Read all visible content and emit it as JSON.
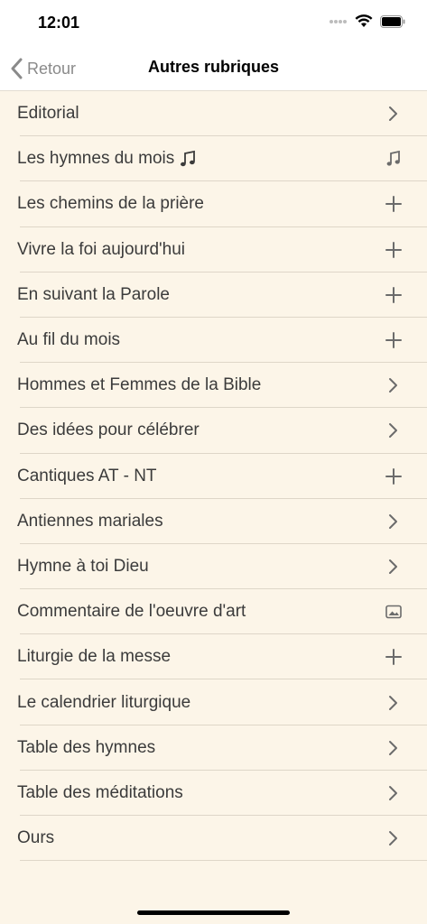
{
  "status": {
    "time": "12:01"
  },
  "nav": {
    "back_label": "Retour",
    "title": "Autres rubriques"
  },
  "items": [
    {
      "label": "Editorial",
      "icon": "chevron-right"
    },
    {
      "label": "Les hymnes du mois",
      "label_icon": "music-note",
      "icon": "music-note"
    },
    {
      "label": "Les chemins de la prière",
      "icon": "plus"
    },
    {
      "label": "Vivre la foi aujourd'hui",
      "icon": "plus"
    },
    {
      "label": "En suivant la Parole",
      "icon": "plus"
    },
    {
      "label": "Au fil du mois",
      "icon": "plus"
    },
    {
      "label": "Hommes et Femmes de la Bible",
      "icon": "chevron-right"
    },
    {
      "label": "Des idées pour célébrer",
      "icon": "chevron-right"
    },
    {
      "label": "Cantiques AT - NT",
      "icon": "plus"
    },
    {
      "label": "Antiennes mariales",
      "icon": "chevron-right"
    },
    {
      "label": "Hymne à toi Dieu",
      "icon": "chevron-right"
    },
    {
      "label": "Commentaire de l'oeuvre d'art",
      "icon": "image"
    },
    {
      "label": "Liturgie de la messe",
      "icon": "plus"
    },
    {
      "label": "Le calendrier liturgique",
      "icon": "chevron-right"
    },
    {
      "label": "Table des hymnes",
      "icon": "chevron-right"
    },
    {
      "label": "Table des méditations",
      "icon": "chevron-right"
    },
    {
      "label": "Ours",
      "icon": "chevron-right"
    }
  ],
  "colors": {
    "background": "#fcf5e8",
    "text": "#3b3b3b",
    "icon": "#6b6b6b"
  }
}
